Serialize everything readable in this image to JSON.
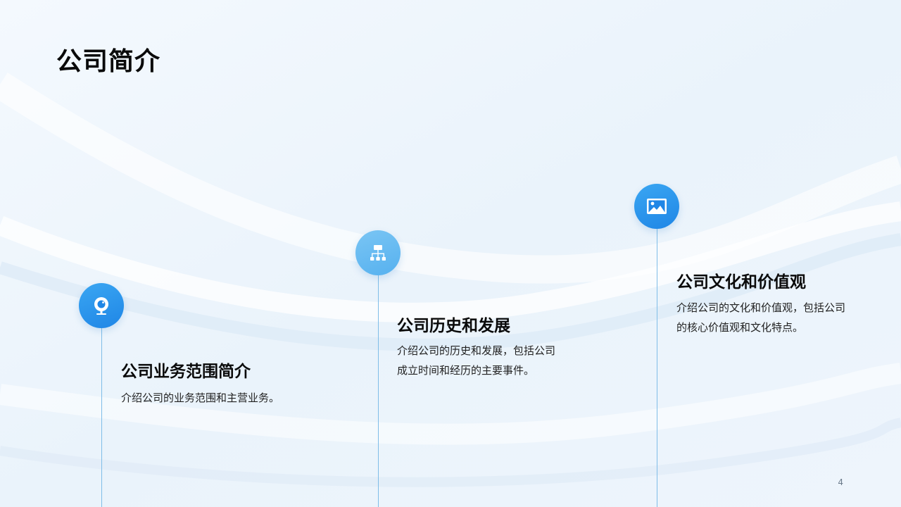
{
  "slide": {
    "title": "公司简介",
    "page_number": "4"
  },
  "items": [
    {
      "icon": "camera-icon",
      "title": "公司业务范围简介",
      "description": "介绍公司的业务范围和主营业务。"
    },
    {
      "icon": "org-chart-icon",
      "title": "公司历史和发展",
      "description": "介绍公司的历史和发展，包括公司成立时间和经历的主要事件。"
    },
    {
      "icon": "image-icon",
      "title": "公司文化和价值观",
      "description": "介绍公司的文化和价值观，包括公司的核心价值观和文化特点。"
    }
  ],
  "colors": {
    "background": "#eef5fc",
    "accent": "#1f86e6",
    "accent_light": "#56b1ef",
    "timeline_line": "#7fbde8"
  }
}
